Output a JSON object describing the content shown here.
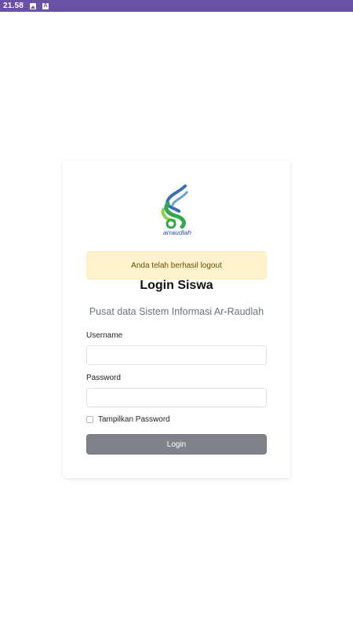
{
  "status_bar": {
    "time": "21.58",
    "icons": [
      "image-icon",
      "a-icon"
    ],
    "background": "#6a51a8"
  },
  "login": {
    "logo_text": "arraudlah",
    "alert_message": "Anda telah berhasil logout",
    "title": "Login Siswa",
    "subtitle": "Pusat data Sistem Informasi Ar-Raudlah",
    "username_label": "Username",
    "username_value": "",
    "password_label": "Password",
    "password_value": "",
    "show_password_label": "Tampilkan Password",
    "show_password_checked": false,
    "login_button": "Login",
    "colors": {
      "alert_bg": "#fff3cd",
      "alert_text": "#664d03",
      "button_bg": "#7f8389"
    }
  }
}
